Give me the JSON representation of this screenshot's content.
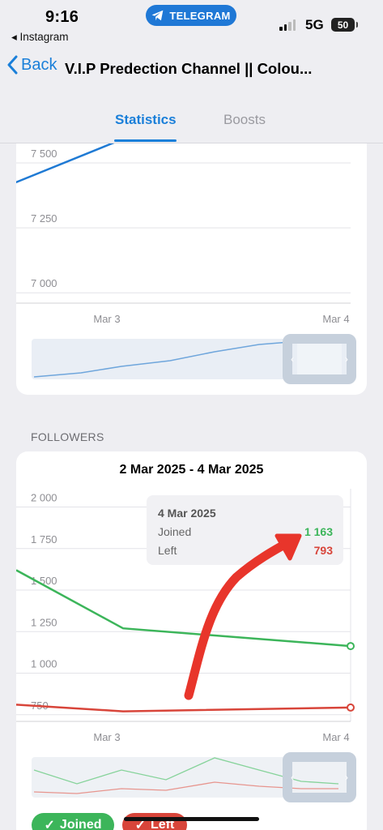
{
  "status_bar": {
    "time": "9:16",
    "back_app": "◂ Instagram",
    "pill": "TELEGRAM",
    "network": "5G",
    "battery": "50"
  },
  "nav": {
    "back_label": "Back",
    "title": "V.I.P Predection Channel || Colou..."
  },
  "tabs": [
    {
      "label": "Statistics",
      "active": true
    },
    {
      "label": "Boosts",
      "active": false
    }
  ],
  "members_chart": {
    "y_ticks": [
      "7 500",
      "7 250",
      "7 000"
    ],
    "x_ticks": [
      "Mar 3",
      "Mar 4"
    ],
    "line_color": "#1f7ad4",
    "chart_data": {
      "type": "line",
      "x": [
        "Mar 2",
        "Mar 3",
        "Mar 4"
      ],
      "series": [
        {
          "values": [
            7350,
            7590,
            7685
          ]
        }
      ],
      "ylim": [
        6960,
        7700
      ]
    }
  },
  "followers": {
    "section_title": "FOLLOWERS",
    "date_range": "2 Mar 2025 - 4 Mar 2025",
    "y_ticks": [
      "2 000",
      "1 750",
      "1 500",
      "1 250",
      "1 000",
      "750"
    ],
    "x_ticks": [
      "Mar 3",
      "Mar 4"
    ],
    "tooltip": {
      "date": "4 Mar 2025",
      "joined_label": "Joined",
      "joined_value": "1 163",
      "left_label": "Left",
      "left_value": "793"
    },
    "colors": {
      "joined": "#3cb55a",
      "left": "#d8453a",
      "arrow": "#e8352b"
    },
    "chart_data": {
      "type": "line",
      "x": [
        "Mar 2",
        "Mar 3",
        "Mar 4"
      ],
      "series": [
        {
          "name": "Joined",
          "values": [
            1620,
            1270,
            1163
          ]
        },
        {
          "name": "Left",
          "values": [
            810,
            770,
            793
          ]
        }
      ],
      "ylim": [
        700,
        2100
      ]
    },
    "toggles": [
      {
        "label": "Joined"
      },
      {
        "label": "Left"
      }
    ]
  }
}
